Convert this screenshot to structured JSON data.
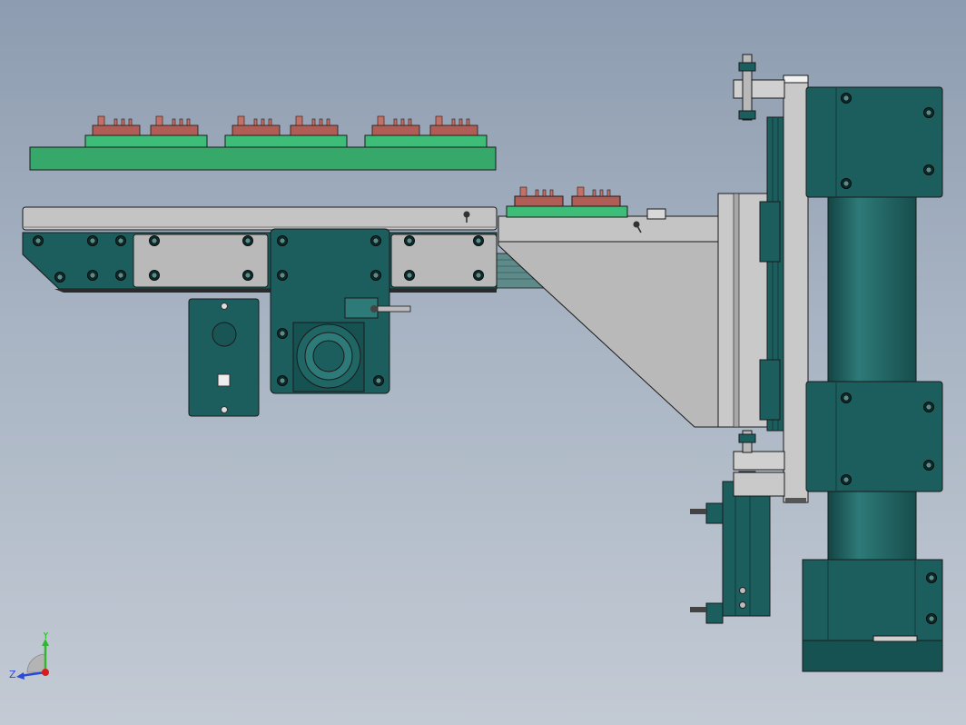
{
  "viewport": {
    "background_top": "#8d9cb0",
    "background_bottom": "#c3cad4"
  },
  "colors": {
    "teal_body": "#1c5e5e",
    "teal_dark": "#134444",
    "teal_light": "#2e7a78",
    "grey_plate": "#b9b9b9",
    "grey_light": "#d2d2d2",
    "pcb_green": "#35a86a",
    "connector_red": "#b05e55",
    "outline": "#1a1a1a"
  },
  "triad": {
    "axis_y_label": "Y",
    "axis_z_label": "Z",
    "y_color": "#2fb82f",
    "z_color": "#2a4ad6",
    "origin_color": "#d81c1c"
  },
  "model": {
    "parts": [
      "pcb-tray-upper",
      "conveyor-rail",
      "conveyor-side-plate",
      "motor-mount",
      "control-box",
      "transfer-bracket",
      "slide-plate",
      "gantry-column",
      "pneumatic-cylinder"
    ]
  }
}
